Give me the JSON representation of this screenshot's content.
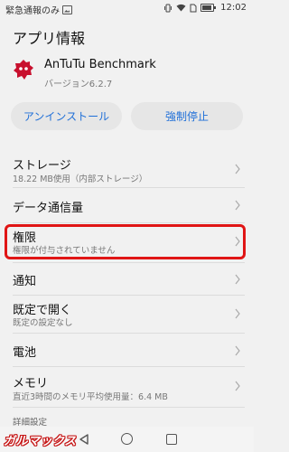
{
  "status_bar": {
    "carrier_text": "緊急通報のみ",
    "time": "12:02",
    "icons": [
      "image-notification-icon",
      "vibrate-icon",
      "wifi-icon",
      "sim-icon",
      "battery-icon"
    ]
  },
  "header": {
    "title": "アプリ情報"
  },
  "app": {
    "name": "AnTuTu Benchmark",
    "version": "バージョン6.2.7",
    "icon": "antutu-app-icon",
    "icon_color": "#c8102e"
  },
  "actions": {
    "uninstall_label": "アンインストール",
    "force_stop_label": "強制停止"
  },
  "settings": [
    {
      "label": "ストレージ",
      "sub": "18.22 MB使用（内部ストレージ）"
    },
    {
      "label": "データ通信量",
      "sub": ""
    },
    {
      "label": "権限",
      "sub": "権限が付与されていません"
    },
    {
      "label": "通知",
      "sub": ""
    },
    {
      "label": "既定で開く",
      "sub": "既定の設定なし"
    },
    {
      "label": "電池",
      "sub": ""
    },
    {
      "label": "メモリ",
      "sub": "直近3時間のメモリ平均使用量：6.4 MB"
    }
  ],
  "section_header": "詳細設定",
  "navbar": {
    "icons": [
      "back-icon",
      "home-icon",
      "recents-icon"
    ]
  },
  "watermark": "ガルマックス",
  "colors": {
    "accent": "#1f6fd8",
    "highlight": "#e01515",
    "background": "#f1f1f1"
  }
}
